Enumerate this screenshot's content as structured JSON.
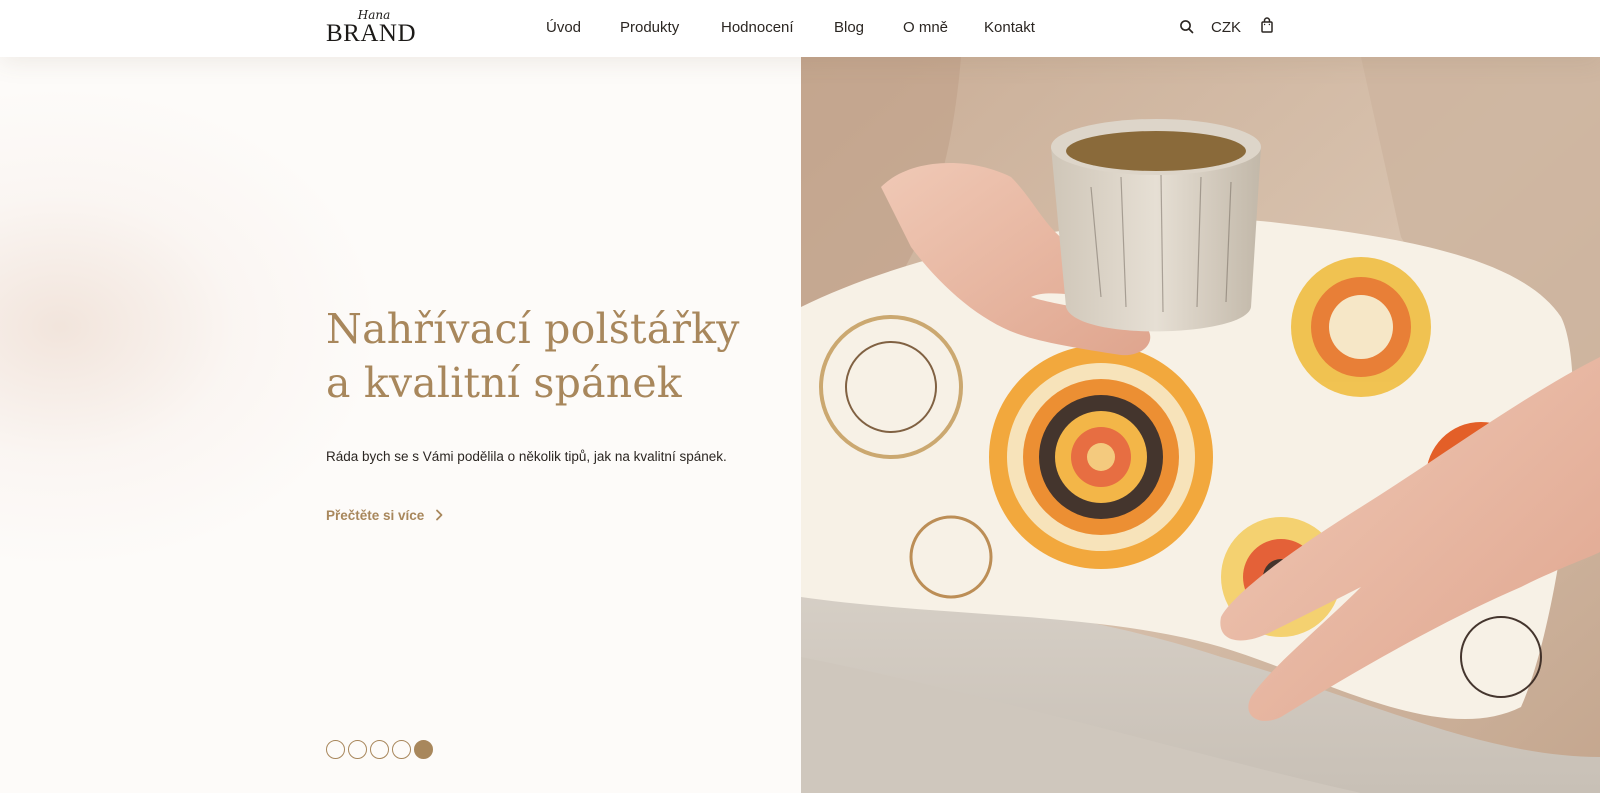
{
  "brand": {
    "script": "Hana",
    "word": "BRAND"
  },
  "nav": {
    "items": [
      "Úvod",
      "Produkty",
      "Hodnocení",
      "Blog",
      "O mně",
      "Kontakt"
    ]
  },
  "header_tools": {
    "currency": "CZK",
    "search_icon": "search-icon",
    "cart_icon": "shopping-bag-icon"
  },
  "hero": {
    "title_line1": "Nahřívací polštářky",
    "title_line2": "a kvalitní spánek",
    "text": "Ráda bych se s Vámi podělila o několik tipů, jak na kvalitní spánek.",
    "link_label": "Přečtěte si více",
    "slides_total": 5,
    "active_slide": 5,
    "image_description": "Hands holding a ceramic cup over a mandala-patterned heating pillow"
  },
  "colors": {
    "accent": "#a8875c",
    "text": "#2b2622",
    "background": "#fdfbf9"
  }
}
